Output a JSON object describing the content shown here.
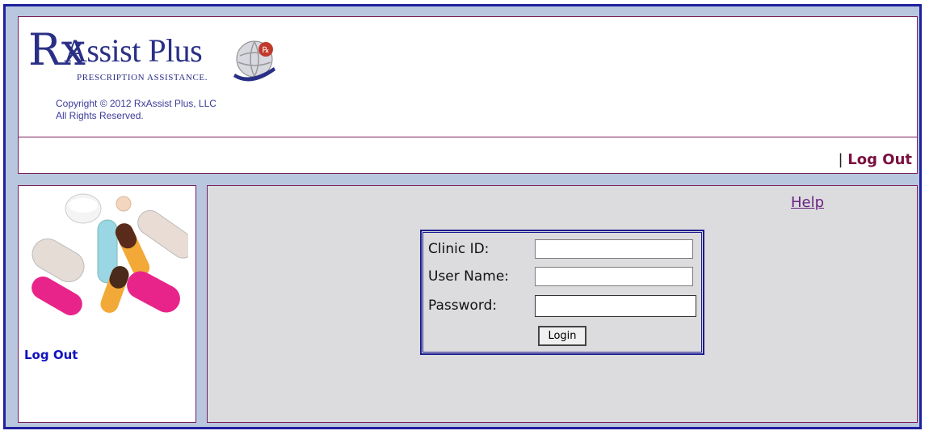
{
  "logo": {
    "rx": "Rx",
    "name": "Assist Plus",
    "tagline": "PRESCRIPTION ASSISTANCE.",
    "brand_color": "#2a2f86",
    "accent_color": "#c0392b"
  },
  "copyright": {
    "line1": "Copyright © 2012 RxAssist Plus, LLC",
    "line2": "All Rights Reserved."
  },
  "header": {
    "separator": "|",
    "logout_label": "Log Out"
  },
  "sidebar": {
    "logout_label": "Log Out"
  },
  "main": {
    "help_label": "Help"
  },
  "login_form": {
    "clinic_label": "Clinic ID:",
    "clinic_value": "",
    "username_label": "User Name:",
    "username_value": "",
    "password_label": "Password:",
    "password_value": "",
    "submit_label": "Login"
  },
  "colors": {
    "frame_bg": "#b8c7dd",
    "frame_border": "#1f1f9f",
    "panel_border": "#7a1f5f",
    "main_bg": "#dcdcdf",
    "link_maroon": "#7a1040",
    "link_blue": "#1010c0",
    "help_purple": "#6a2380"
  }
}
